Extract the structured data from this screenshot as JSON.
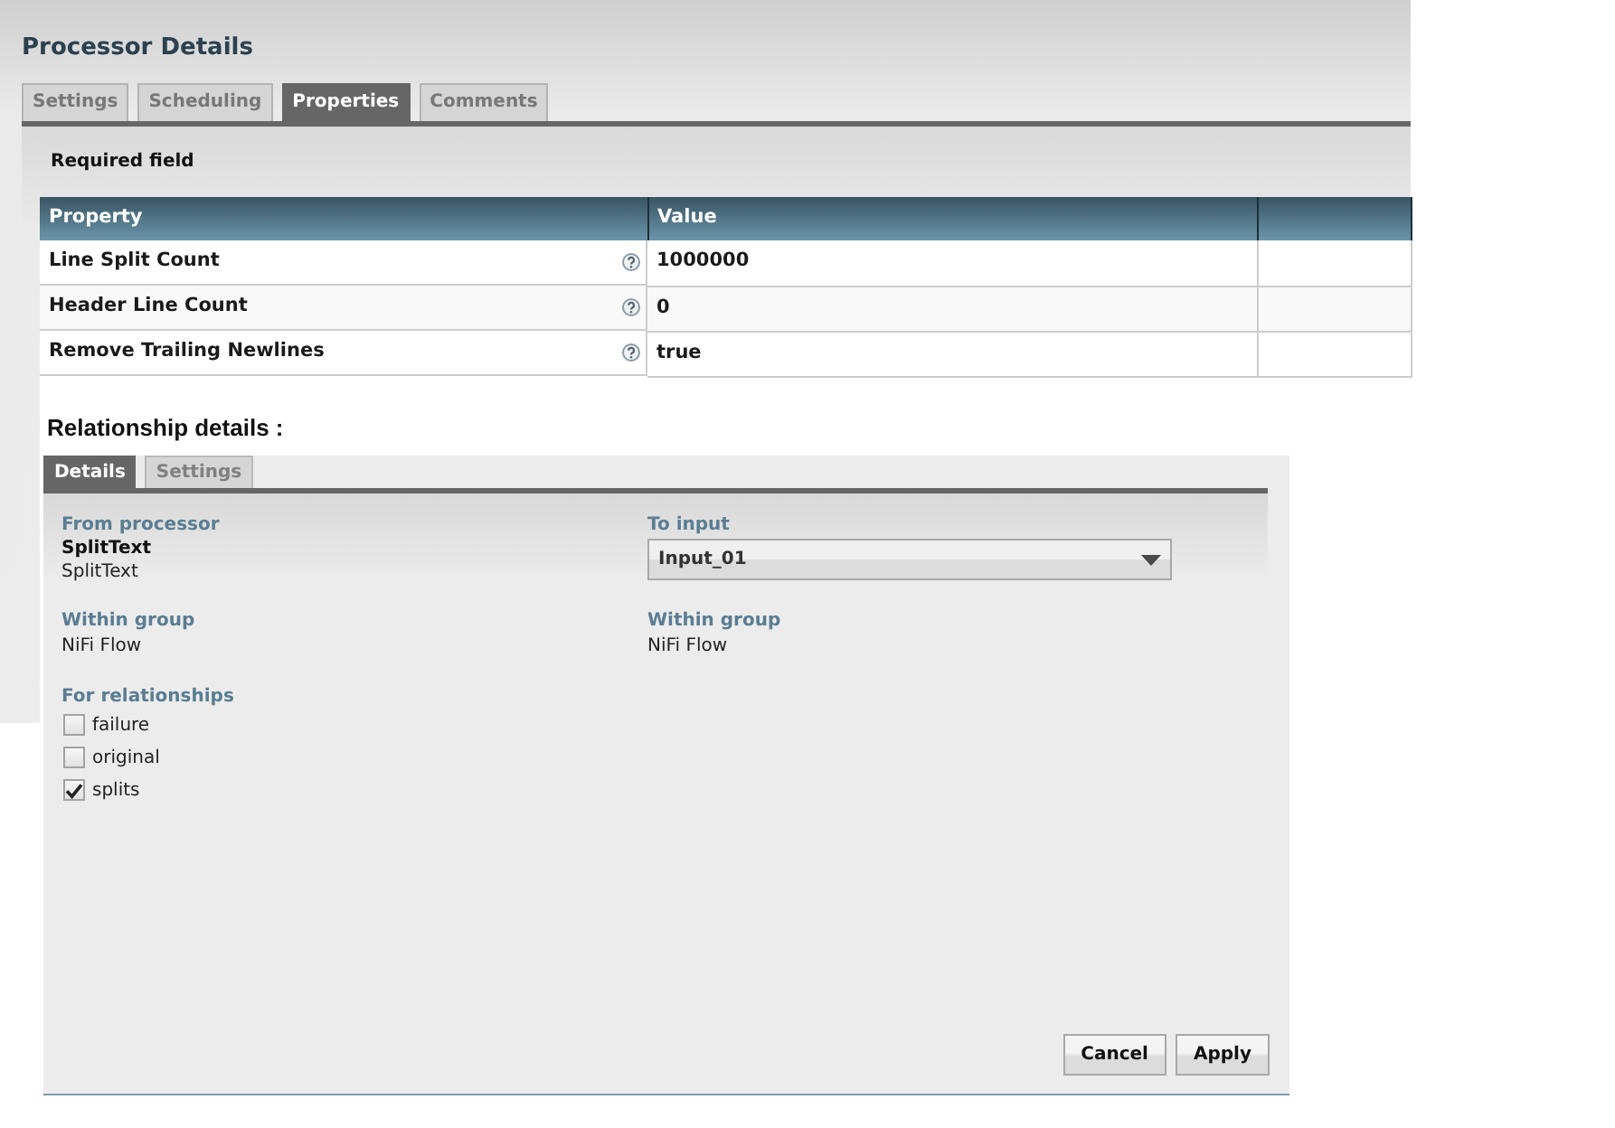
{
  "dialog": {
    "title": "Processor Details",
    "tabs": [
      {
        "label": "Settings",
        "selected": false
      },
      {
        "label": "Scheduling",
        "selected": false
      },
      {
        "label": "Properties",
        "selected": true
      },
      {
        "label": "Comments",
        "selected": false
      }
    ],
    "required_note": "Required field",
    "table": {
      "columns": [
        "Property",
        "Value"
      ],
      "rows": [
        {
          "property": "Line Split Count",
          "value": "1000000"
        },
        {
          "property": "Header Line Count",
          "value": "0"
        },
        {
          "property": "Remove Trailing Newlines",
          "value": "true"
        }
      ]
    },
    "relationship_heading": "Relationship details :"
  },
  "relationship_panel": {
    "tabs": [
      {
        "label": "Details",
        "selected": true
      },
      {
        "label": "Settings",
        "selected": false
      }
    ],
    "from_processor": {
      "label": "From processor",
      "name": "SplitText",
      "type": "SplitText"
    },
    "to_input": {
      "label": "To input",
      "value": "Input_01"
    },
    "from_group": {
      "label": "Within group",
      "value": "NiFi Flow"
    },
    "to_group": {
      "label": "Within group",
      "value": "NiFi Flow"
    },
    "relationships": {
      "label": "For relationships",
      "items": [
        {
          "label": "failure",
          "checked": false
        },
        {
          "label": "original",
          "checked": false
        },
        {
          "label": "splits",
          "checked": true
        }
      ]
    },
    "buttons": [
      "Cancel",
      "Apply"
    ]
  }
}
